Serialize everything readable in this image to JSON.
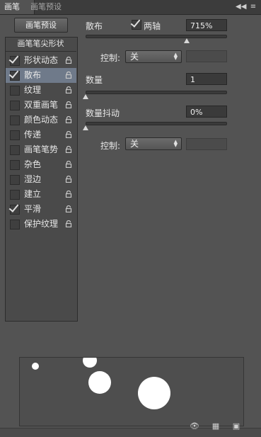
{
  "header": {
    "tab_brush": "画笔",
    "tab_presets": "画笔预设",
    "collapse_icon": "double-chevron-left-icon",
    "menu_icon": "panel-menu-icon"
  },
  "left": {
    "preset_button": "画笔预设",
    "list_title": "画笔笔尖形状",
    "items": [
      {
        "label": "形状动态",
        "checked": true
      },
      {
        "label": "散布",
        "checked": true,
        "selected": true
      },
      {
        "label": "纹理",
        "checked": false
      },
      {
        "label": "双重画笔",
        "checked": false
      },
      {
        "label": "颜色动态",
        "checked": false
      },
      {
        "label": "传递",
        "checked": false
      },
      {
        "label": "画笔笔势",
        "checked": false
      },
      {
        "label": "杂色",
        "checked": false
      },
      {
        "label": "湿边",
        "checked": false
      },
      {
        "label": "建立",
        "checked": false
      },
      {
        "label": "平滑",
        "checked": true
      },
      {
        "label": "保护纹理",
        "checked": false
      }
    ]
  },
  "scatter": {
    "label": "散布",
    "both_axes_label": "两轴",
    "both_axes_checked": true,
    "value": "715%",
    "slider_fraction": 0.715,
    "control_label": "控制:",
    "control_value": "关"
  },
  "count": {
    "label": "数量",
    "value": "1",
    "slider_fraction": 0.0
  },
  "count_jitter": {
    "label": "数量抖动",
    "value": "0%",
    "slider_fraction": 0.0,
    "control_label": "控制:",
    "control_value": "关"
  },
  "footer": {
    "icons": [
      "toggle-live-tip-icon",
      "grid-icon",
      "new-preset-icon"
    ]
  }
}
